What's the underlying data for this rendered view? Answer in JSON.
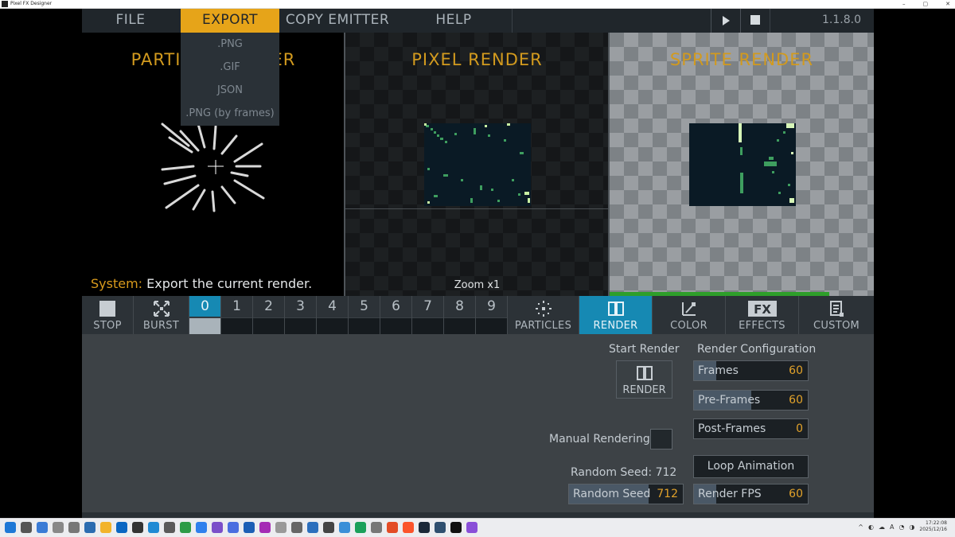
{
  "window": {
    "title": "Pixel FX Designer",
    "controls": [
      "–",
      "▢",
      "✕"
    ]
  },
  "menu": {
    "items": [
      "FILE",
      "EXPORT",
      "COPY EMITTER",
      "HELP"
    ],
    "active": "EXPORT",
    "version": "1.1.8.0"
  },
  "export_menu": {
    "items": [
      ".PNG",
      ".GIF",
      "JSON",
      ".PNG (by frames)"
    ]
  },
  "panels": {
    "particle": {
      "title": "PARTICLE RENDER",
      "system_label": "System:",
      "system_message": "Export the current render."
    },
    "pixel": {
      "title": "PIXEL RENDER",
      "zoom": "Zoom x1"
    },
    "sprite": {
      "title": "SPRITE RENDER",
      "progress": 0.83
    }
  },
  "toolbar": {
    "stop": "STOP",
    "burst": "BURST",
    "slots": [
      "0",
      "1",
      "2",
      "3",
      "4",
      "5",
      "6",
      "7",
      "8",
      "9"
    ],
    "active_slot": "0",
    "tabs": [
      "PARTICLES",
      "RENDER",
      "COLOR",
      "EFFECTS",
      "CUSTOM"
    ],
    "active_tab": "RENDER"
  },
  "controls": {
    "start_render": "Start Render",
    "render_button": "RENDER",
    "render_config": "Render Configuration",
    "frames": {
      "label": "Frames",
      "value": "60"
    },
    "pre_frames": {
      "label": "Pre-Frames",
      "value": "60"
    },
    "post_frames": {
      "label": "Post-Frames",
      "value": "0"
    },
    "manual_rendering": "Manual Rendering",
    "loop_animation": "Loop Animation",
    "random_seed_label": "Random Seed: 712",
    "random_seed": {
      "label": "Random Seed",
      "value": "712"
    },
    "render_fps": {
      "label": "Render FPS",
      "value": "60"
    }
  },
  "taskbar": {
    "tray_lang": "A",
    "time": "17:22:08",
    "date": "2025/12/16"
  },
  "colors": {
    "accent": "#e6a419",
    "active_blue": "#1689b3",
    "value_orange": "#e2a22a",
    "title_gold": "#d29a1e"
  }
}
